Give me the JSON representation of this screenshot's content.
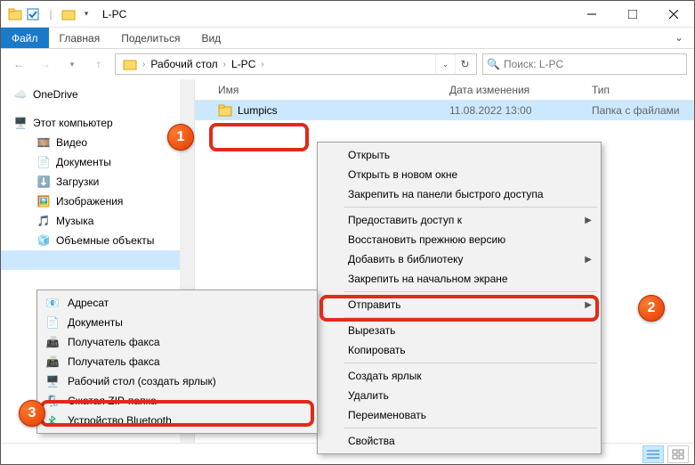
{
  "window": {
    "title": "L-PC"
  },
  "ribbon": {
    "file": "Файл",
    "tabs": [
      "Главная",
      "Поделиться",
      "Вид"
    ]
  },
  "address": {
    "crumbs": [
      "Рабочий стол",
      "L-PC"
    ],
    "search_placeholder": "Поиск: L-PC"
  },
  "tree": {
    "onedrive": "OneDrive",
    "thispc": "Этот компьютер",
    "children": [
      "Видео",
      "Документы",
      "Загрузки",
      "Изображения",
      "Музыка",
      "Объемные объекты"
    ],
    "truncated": [
      "Адресат",
      "Документы",
      "Получатель факса",
      "Получатель факса",
      "Рабочий стол (создать ярлык)",
      "Сжатая ZIP-папка",
      "Устройство Bluetooth"
    ]
  },
  "columns": {
    "name": "Имя",
    "date": "Дата изменения",
    "type": "Тип"
  },
  "rows": [
    {
      "name": "Lumpics",
      "date": "11.08.2022 13:00",
      "type": "Папка с файлами"
    }
  ],
  "context_main": {
    "g1": [
      "Открыть",
      "Открыть в новом окне",
      "Закрепить на панели быстрого доступа"
    ],
    "g2": [
      {
        "label": "Предоставить доступ к",
        "sub": true
      },
      {
        "label": "Восстановить прежнюю версию",
        "sub": false
      },
      {
        "label": "Добавить в библиотеку",
        "sub": true
      },
      {
        "label": "Закрепить на начальном экране",
        "sub": false
      }
    ],
    "send": "Отправить",
    "g3": [
      "Вырезать",
      "Копировать"
    ],
    "g4": [
      "Создать ярлык",
      "Удалить",
      "Переименовать"
    ],
    "g5": [
      "Свойства"
    ]
  },
  "context_sub": {
    "items": [
      "Адресат",
      "Документы",
      "Получатель факса",
      "Получатель факса",
      "Рабочий стол (создать ярлык)",
      "Сжатая ZIP-папка",
      "Устройство Bluetooth"
    ]
  },
  "badges": {
    "b1": "1",
    "b2": "2",
    "b3": "3"
  }
}
